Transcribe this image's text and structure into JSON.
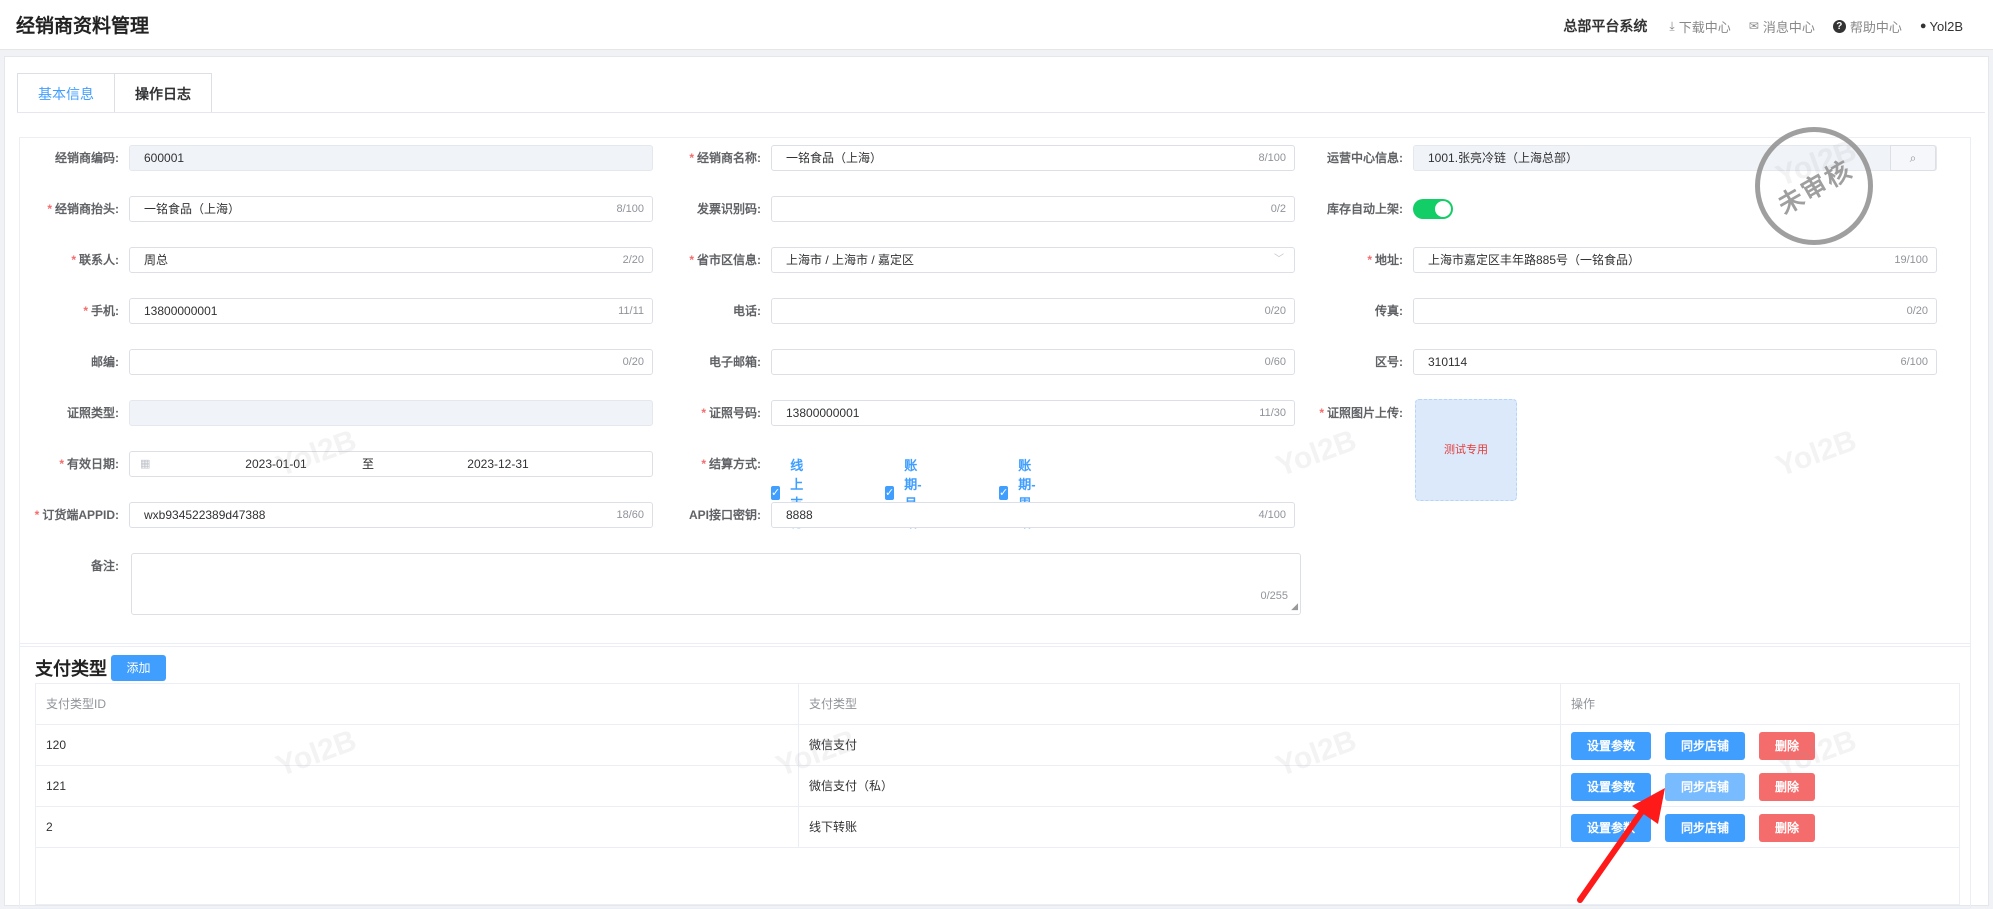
{
  "header": {
    "title": "经销商资料管理",
    "system": "总部平台系统",
    "links": [
      {
        "icon": "⤓",
        "label": "下载中心"
      },
      {
        "icon": "✉",
        "label": "消息中心"
      },
      {
        "icon": "?",
        "label": "帮助中心"
      }
    ],
    "user": "Yol2B"
  },
  "tabs": [
    "基本信息",
    "操作日志"
  ],
  "stamp": "未审核",
  "form": {
    "dealer_code": {
      "label": "经销商编码:",
      "value": "600001"
    },
    "dealer_name": {
      "label": "经销商名称:",
      "value": "一铭食品（上海）",
      "count": "8/100"
    },
    "ops_center": {
      "label": "运营中心信息:",
      "value": "1001.张亮冷链（上海总部）"
    },
    "dealer_header": {
      "label": "经销商抬头:",
      "value": "一铭食品（上海）",
      "count": "8/100"
    },
    "invoice_code": {
      "label": "发票识别码:",
      "value": "",
      "count": "0/2"
    },
    "auto_shelf": {
      "label": "库存自动上架:",
      "on": true
    },
    "contact": {
      "label": "联系人:",
      "value": "周总",
      "count": "2/20"
    },
    "region": {
      "label": "省市区信息:",
      "value": "上海市 / 上海市 / 嘉定区"
    },
    "address": {
      "label": "地址:",
      "value": "上海市嘉定区丰年路885号（一铭食品）",
      "count": "19/100"
    },
    "mobile": {
      "label": "手机:",
      "value": "13800000001",
      "count": "11/11"
    },
    "phone": {
      "label": "电话:",
      "value": "",
      "count": "0/20"
    },
    "fax": {
      "label": "传真:",
      "value": "",
      "count": "0/20"
    },
    "postcode": {
      "label": "邮编:",
      "value": "",
      "count": "0/20"
    },
    "email": {
      "label": "电子邮箱:",
      "value": "",
      "count": "0/60"
    },
    "area_code": {
      "label": "区号:",
      "value": "310114",
      "count": "6/100"
    },
    "cert_type": {
      "label": "证照类型:",
      "value": ""
    },
    "cert_no": {
      "label": "证照号码:",
      "value": "13800000001",
      "count": "11/30"
    },
    "cert_image": {
      "label": "证照图片上传:",
      "text": "测试专用"
    },
    "valid_date": {
      "label": "有效日期:",
      "start": "2023-01-01",
      "sep": "至",
      "end": "2023-12-31"
    },
    "settlement": {
      "label": "结算方式:",
      "options": [
        "线上支付",
        "账期-月结",
        "账期-周结"
      ]
    },
    "appid": {
      "label": "订货端APPID:",
      "value": "wxb934522389d47388",
      "count": "18/60"
    },
    "api_key": {
      "label": "API接口密钥:",
      "value": "8888",
      "count": "4/100"
    },
    "remark": {
      "label": "备注:",
      "value": "",
      "count": "0/255"
    }
  },
  "payment": {
    "title": "支付类型",
    "add_label": "添加",
    "columns": [
      "支付类型ID",
      "支付类型",
      "操作"
    ],
    "rows": [
      {
        "id": "120",
        "type": "微信支付"
      },
      {
        "id": "121",
        "type": "微信支付（私）"
      },
      {
        "id": "2",
        "type": "线下转账"
      }
    ],
    "actions": {
      "set": "设置参数",
      "sync": "同步店铺",
      "del": "删除"
    }
  },
  "watermark": "Yol2B",
  "colors": {
    "primary": "#409eff",
    "danger": "#f56c6c",
    "switch_on": "#13ce66",
    "arrow": "#ff1a1a"
  }
}
